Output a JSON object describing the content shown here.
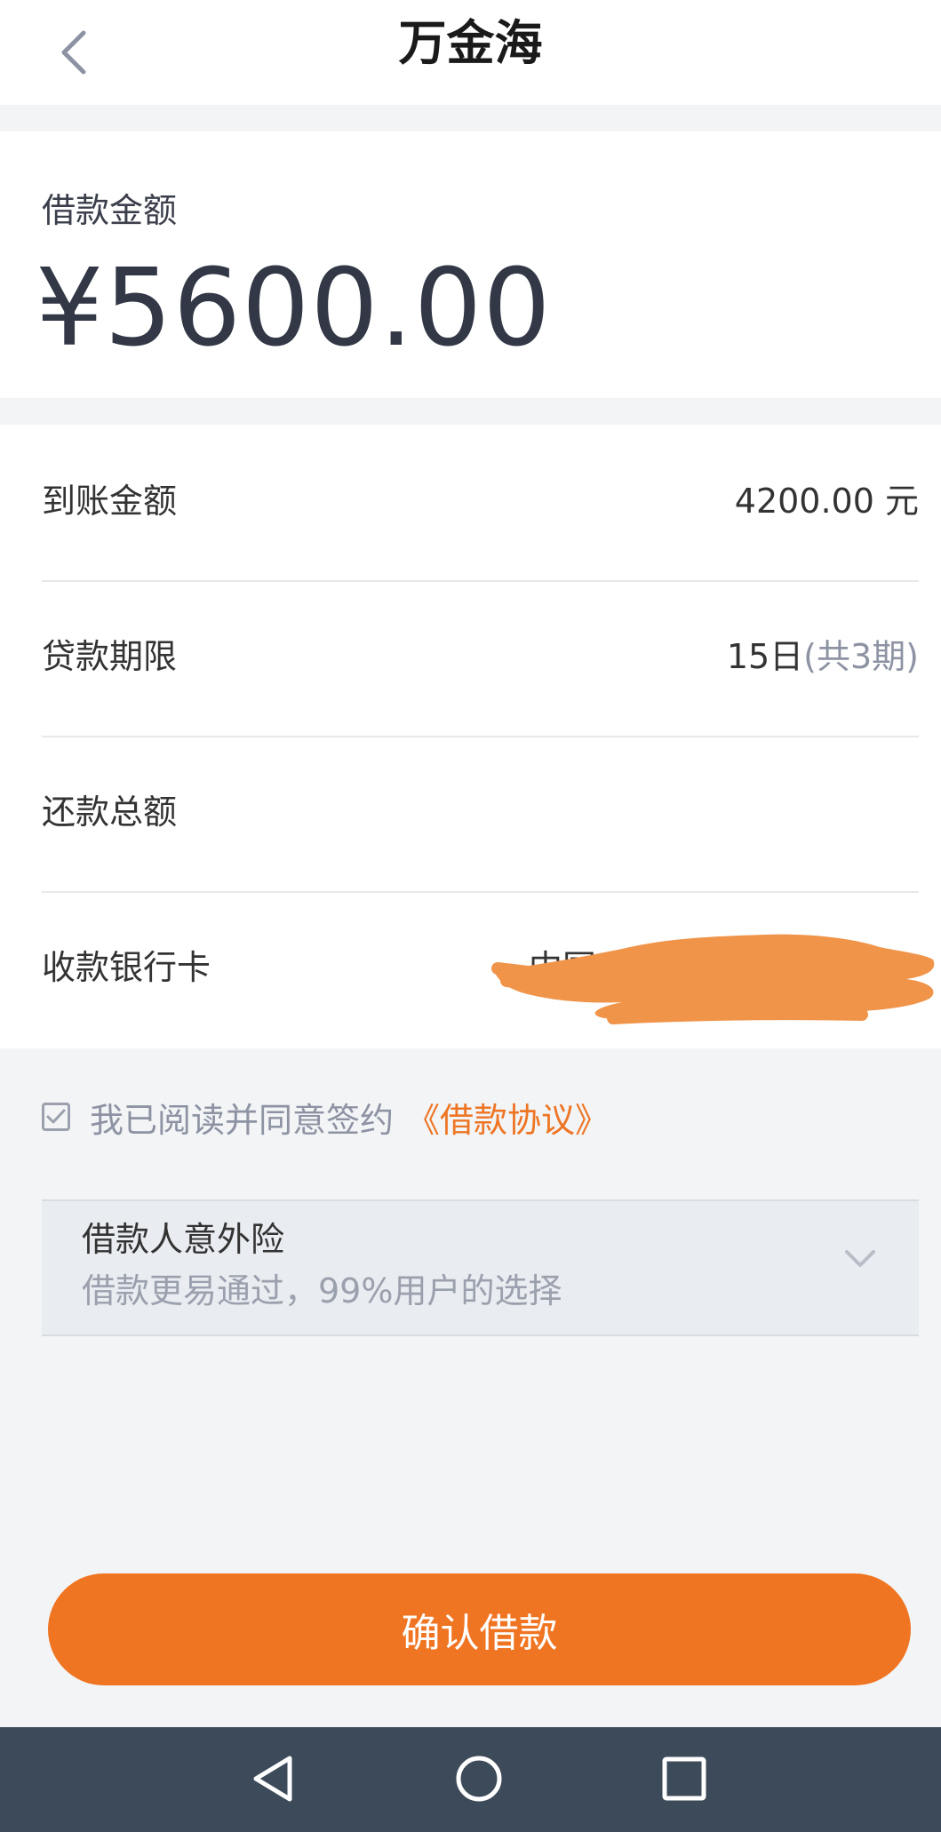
{
  "header": {
    "title": "万金海"
  },
  "loan": {
    "amount_label": "借款金额",
    "amount_value": "¥5600.00"
  },
  "details": {
    "received_label": "到账金额",
    "received_value": "4200.00 元",
    "term_label": "贷款期限",
    "term_value_main": "15日",
    "term_value_extra": "(共3期)",
    "total_repay_label": "还款总额",
    "bank_card_label": "收款银行卡",
    "bank_card_value_partial": "中国"
  },
  "agreement": {
    "checked": true,
    "text": "我已阅读并同意签约",
    "link": "《借款协议》"
  },
  "insurance": {
    "title": "借款人意外险",
    "subtitle": "借款更易通过，99%用户的选择"
  },
  "confirm_button": {
    "label": "确认借款"
  },
  "colors": {
    "accent": "#f07522",
    "link": "#ee7524",
    "system_bar": "#3d4a5a",
    "redaction": "#f0944a"
  },
  "icons": {
    "back": "chevron-left-icon",
    "checkbox": "checkbox-checked-icon",
    "expand": "chevron-down-icon",
    "system_back": "triangle-back-icon",
    "system_home": "circle-home-icon",
    "system_recents": "square-recents-icon"
  }
}
